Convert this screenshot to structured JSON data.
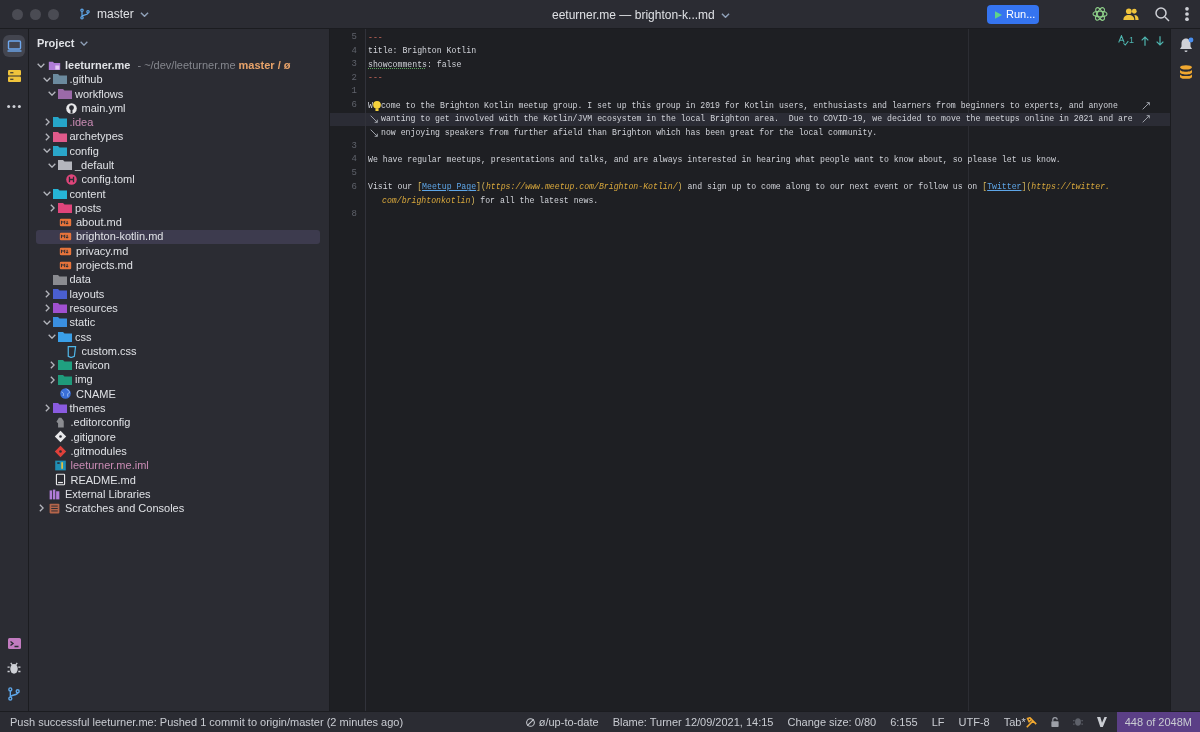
{
  "window": {
    "branch": "master",
    "title": "eeturner.me — brighton-k...md",
    "run_button": "Run..."
  },
  "tool_strip": {
    "items": [
      {
        "selected": true
      },
      {
        "selected": false
      },
      {
        "selected": false
      }
    ]
  },
  "project": {
    "title": "Project",
    "tree": [
      {
        "label": "leeturner.me",
        "kind": "project",
        "path": "- ~/dev/leeturner.me",
        "branch": "master / ø",
        "expanded": true,
        "selected": false,
        "ignored": false,
        "children": [
          {
            "label": ".github",
            "kind": "folder",
            "color": "#6b8a9e",
            "expanded": true,
            "selected": false,
            "ignored": false,
            "children": [
              {
                "label": "workflows",
                "kind": "folder",
                "color": "#9b6aa8",
                "expanded": true,
                "selected": false,
                "ignored": false,
                "children": [
                  {
                    "label": "main.yml",
                    "kind": "github",
                    "selected": false,
                    "ignored": false
                  }
                ]
              }
            ]
          },
          {
            "label": ".idea",
            "kind": "folder",
            "color": "#26a6c9",
            "expanded": false,
            "selected": false,
            "ignored": true
          },
          {
            "label": "archetypes",
            "kind": "folder",
            "color": "#e05a8a",
            "expanded": false,
            "selected": false,
            "ignored": false
          },
          {
            "label": "config",
            "kind": "folder",
            "color": "#2aa6c9",
            "expanded": true,
            "selected": false,
            "ignored": false,
            "children": [
              {
                "label": "_default",
                "kind": "folder",
                "color": "#b4b6bd",
                "expanded": true,
                "selected": false,
                "ignored": false,
                "children": [
                  {
                    "label": "config.toml",
                    "kind": "hugo",
                    "selected": false,
                    "ignored": false
                  }
                ]
              }
            ]
          },
          {
            "label": "content",
            "kind": "folder",
            "color": "#26b5d6",
            "expanded": true,
            "selected": false,
            "ignored": false,
            "children": [
              {
                "label": "posts",
                "kind": "folder",
                "color": "#e0457b",
                "expanded": false,
                "selected": false,
                "ignored": false
              },
              {
                "label": "about.md",
                "kind": "markdown",
                "selected": false,
                "ignored": false
              },
              {
                "label": "brighton-kotlin.md",
                "kind": "markdown",
                "selected": true,
                "ignored": false
              },
              {
                "label": "privacy.md",
                "kind": "markdown",
                "selected": false,
                "ignored": false
              },
              {
                "label": "projects.md",
                "kind": "markdown",
                "selected": false,
                "ignored": false
              }
            ]
          },
          {
            "label": "data",
            "kind": "folder",
            "color": "#8a8b90",
            "selected": false,
            "ignored": false
          },
          {
            "label": "layouts",
            "kind": "folder",
            "color": "#4a5fd0",
            "expanded": false,
            "selected": false,
            "ignored": false
          },
          {
            "label": "resources",
            "kind": "folder",
            "color": "#a050d0",
            "expanded": false,
            "selected": false,
            "ignored": false
          },
          {
            "label": "static",
            "kind": "folder",
            "color": "#3a8fe0",
            "expanded": true,
            "selected": false,
            "ignored": false,
            "children": [
              {
                "label": "css",
                "kind": "folder",
                "color": "#3a9fe8",
                "expanded": true,
                "selected": false,
                "ignored": false,
                "children": [
                  {
                    "label": "custom.css",
                    "kind": "stylesheet",
                    "selected": false,
                    "ignored": false
                  }
                ]
              },
              {
                "label": "favicon",
                "kind": "folder",
                "color": "#20a080",
                "expanded": false,
                "selected": false,
                "ignored": false
              },
              {
                "label": "img",
                "kind": "folder",
                "color": "#1f9a7a",
                "expanded": false,
                "selected": false,
                "ignored": false
              },
              {
                "label": "CNAME",
                "kind": "globe",
                "selected": false,
                "ignored": false
              }
            ]
          },
          {
            "label": "themes",
            "kind": "folder",
            "color": "#8a5be0",
            "expanded": false,
            "selected": false,
            "ignored": false
          },
          {
            "label": ".editorconfig",
            "kind": "config",
            "selected": false,
            "ignored": false
          },
          {
            "label": ".gitignore",
            "kind": "gitignore",
            "selected": false,
            "ignored": false
          },
          {
            "label": ".gitmodules",
            "kind": "gitmodules",
            "selected": false,
            "ignored": false
          },
          {
            "label": "leeturner.me.iml",
            "kind": "module",
            "selected": false,
            "ignored": true
          },
          {
            "label": "README.md",
            "kind": "readme",
            "selected": false,
            "ignored": false
          }
        ]
      },
      {
        "label": "External Libraries",
        "kind": "libraries",
        "selected": false,
        "ignored": false
      },
      {
        "label": "Scratches and Consoles",
        "kind": "scratches",
        "expanded": false,
        "selected": false,
        "ignored": false
      }
    ]
  },
  "editor": {
    "inspection_count": "1",
    "rows": [
      {
        "kind": "line",
        "number": "5",
        "current": false,
        "wraps": false,
        "segments": [
          {
            "kind": "dash",
            "text": "---"
          }
        ]
      },
      {
        "kind": "line",
        "number": "4",
        "current": false,
        "wraps": false,
        "segments": [
          {
            "kind": "plain",
            "text": "title: Brighton Kotlin"
          }
        ]
      },
      {
        "kind": "line",
        "number": "3",
        "current": false,
        "wraps": false,
        "segments": [
          {
            "kind": "typo",
            "text": "showcomments"
          },
          {
            "kind": "plain",
            "text": ": false"
          }
        ]
      },
      {
        "kind": "line",
        "number": "2",
        "current": false,
        "wraps": false,
        "segments": [
          {
            "kind": "dash",
            "text": "---"
          }
        ]
      },
      {
        "kind": "line",
        "number": "1",
        "current": false,
        "wraps": false,
        "segments": []
      },
      {
        "kind": "line",
        "number": "6",
        "current": false,
        "wraps": true,
        "segments": [
          {
            "kind": "plain",
            "text": "W"
          },
          {
            "kind": "bulb"
          },
          {
            "kind": "plain",
            "text": "come to the Brighton Kotlin meetup group. I set up this group in 2019 for Kotlin users, enthusiasts and learners from beginners to experts, and anyone"
          }
        ]
      },
      {
        "kind": "soft",
        "current": true,
        "wraps": true,
        "segments": [
          {
            "kind": "plain",
            "text": "wanting to get involved with the Kotlin/JVM ecosystem in the local Brighton area.  Due to COVID-19, we decided to move the meetups online in 2021 and are"
          }
        ]
      },
      {
        "kind": "soft",
        "current": false,
        "wraps": false,
        "segments": [
          {
            "kind": "plain",
            "text": "now enjoying speakers from further afield than Brighton which has been great for the local community."
          }
        ]
      },
      {
        "kind": "line",
        "number": "3",
        "current": false,
        "wraps": false,
        "segments": []
      },
      {
        "kind": "line",
        "number": "4",
        "current": false,
        "wraps": false,
        "segments": [
          {
            "kind": "plain",
            "text": "We have regular meetups, presentations and talks, and are always interested in hearing what people want to know about, so please let us know."
          }
        ]
      },
      {
        "kind": "line",
        "number": "5",
        "current": false,
        "wraps": false,
        "segments": []
      },
      {
        "kind": "line",
        "number": "6",
        "current": false,
        "wraps": false,
        "segments": [
          {
            "kind": "plain",
            "text": "Visit our "
          },
          {
            "kind": "bracket",
            "text": "["
          },
          {
            "kind": "link",
            "text": "Meetup Page"
          },
          {
            "kind": "bracket",
            "text": "]("
          },
          {
            "kind": "url",
            "text": "https://www.meetup.com/Brighton-Kotlin/"
          },
          {
            "kind": "bracket",
            "text": ")"
          },
          {
            "kind": "plain",
            "text": " and sign up to come along to our next event or follow us on "
          },
          {
            "kind": "bracket",
            "text": "["
          },
          {
            "kind": "link",
            "text": "Twitter"
          },
          {
            "kind": "bracket",
            "text": "]("
          },
          {
            "kind": "url",
            "text": "https://twitter."
          }
        ]
      },
      {
        "kind": "indent",
        "current": false,
        "wraps": false,
        "segments": [
          {
            "kind": "url",
            "text": "com/brightonkotlin"
          },
          {
            "kind": "bracket",
            "text": ")"
          },
          {
            "kind": "plain",
            "text": " for all the latest news."
          }
        ]
      },
      {
        "kind": "line",
        "number": "8",
        "current": false,
        "wraps": false,
        "segments": []
      }
    ]
  },
  "status_bar": {
    "message": "Push successful leeturner.me: Pushed 1 commit to origin/master (2 minutes ago)",
    "items": [
      {
        "kind": "vcs",
        "text": "ø/up-to-date"
      },
      {
        "kind": "text",
        "text": "Blame: Turner 12/09/2021, 14:15"
      },
      {
        "kind": "text",
        "text": "Change size: 0/80"
      },
      {
        "kind": "text",
        "text": "6:155"
      },
      {
        "kind": "text",
        "text": "LF"
      },
      {
        "kind": "text",
        "text": "UTF-8"
      },
      {
        "kind": "indent",
        "text": "Tab*"
      },
      {
        "kind": "lock"
      },
      {
        "kind": "bug"
      },
      {
        "kind": "vim"
      },
      {
        "kind": "memory",
        "text": "448 of 2048M"
      }
    ]
  }
}
